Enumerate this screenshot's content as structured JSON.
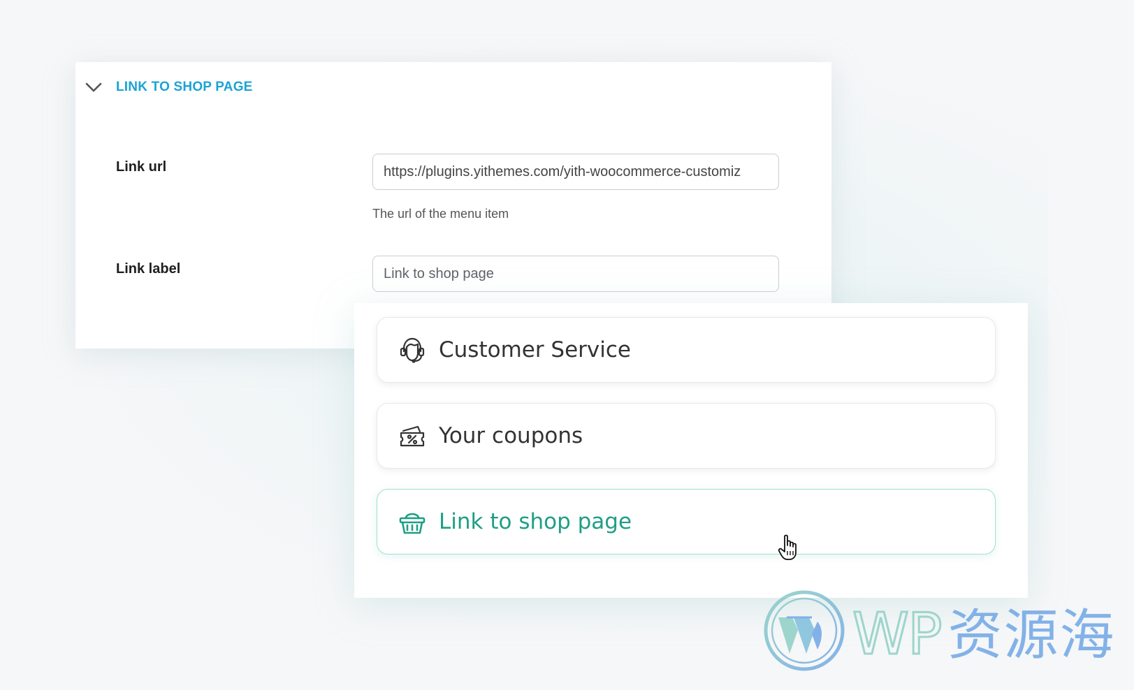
{
  "settings": {
    "section_title": "LINK TO SHOP PAGE",
    "fields": {
      "link_url": {
        "label": "Link url",
        "value": "https://plugins.yithemes.com/yith-woocommerce-customiz",
        "help": "The url of the menu item"
      },
      "link_label": {
        "label": "Link label",
        "value": "Link to shop page"
      }
    }
  },
  "preview": {
    "items": [
      {
        "label": "Customer Service",
        "icon": "customer-service-icon",
        "active": false
      },
      {
        "label": "Your coupons",
        "icon": "coupon-icon",
        "active": false
      },
      {
        "label": "Link to shop page",
        "icon": "basket-icon",
        "active": true
      }
    ],
    "accent_color": "#1e9e86"
  },
  "watermark": {
    "latin": "WP",
    "cjk": "资源海"
  },
  "colors": {
    "section_title": "#1ba3d6",
    "active_border": "#9fe0d2",
    "watermark_green": "#8ed0c5",
    "watermark_blue": "#6fa6e6"
  }
}
